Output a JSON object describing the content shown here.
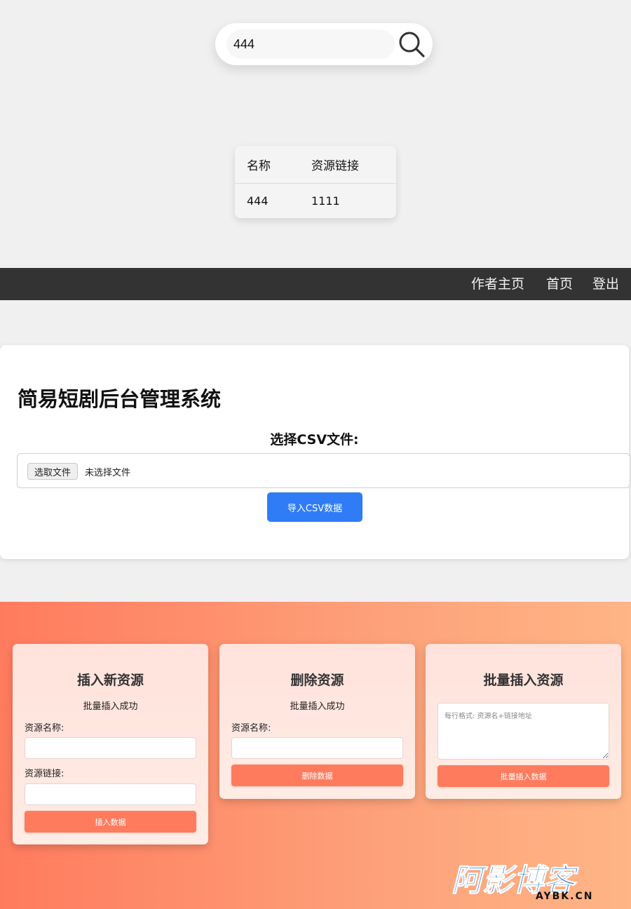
{
  "search": {
    "value": "444",
    "button_icon": "search-icon"
  },
  "results": {
    "headers": [
      "名称",
      "资源链接"
    ],
    "rows": [
      [
        "444",
        "1111"
      ]
    ]
  },
  "nav": {
    "items": [
      "作者主页",
      "首页",
      "登出"
    ],
    "bg_color": "#333333"
  },
  "admin": {
    "title": "简易短剧后台管理系统",
    "csv_label": "选择CSV文件:",
    "file_button": "选取文件",
    "file_status": "未选择文件",
    "import_button": "导入CSV数据",
    "accent_color": "#2f7cf6"
  },
  "cards": {
    "insert": {
      "title": "插入新资源",
      "status": "批量插入成功",
      "name_label": "资源名称:",
      "link_label": "资源链接:",
      "button": "插入数据"
    },
    "delete": {
      "title": "删除资源",
      "status": "批量插入成功",
      "name_label": "资源名称:",
      "button": "删除数据"
    },
    "bulk": {
      "title": "批量插入资源",
      "placeholder": "每行格式: 资源名+链接地址",
      "button": "批量插入数据"
    },
    "button_color": "#ff7b5e"
  },
  "watermark": {
    "text": "阿影博客",
    "domain": "AYBK.CN",
    "color": "#1a73e8"
  }
}
